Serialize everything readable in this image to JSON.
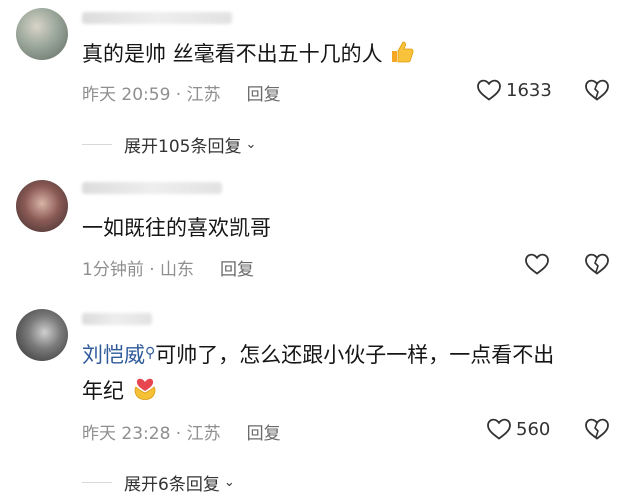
{
  "comments": [
    {
      "text": "真的是帅 丝毫看不出五十几的人",
      "emoji": "thumbs-up",
      "time": "昨天 20:59 · 江苏",
      "reply": "回复",
      "likes": "1633",
      "expand": "展开105条回复"
    },
    {
      "text": "一如既往的喜欢凯哥",
      "time": "1分钟前 · 山东",
      "reply": "回复"
    },
    {
      "mention": "刘恺威",
      "text_line1": "可帅了，怎么还跟小伙子一样，一点看不出",
      "text_line2": "年纪",
      "emoji": "heart-hands",
      "time": "昨天 23:28 · 江苏",
      "reply": "回复",
      "likes": "560",
      "expand": "展开6条回复"
    }
  ],
  "colors": {
    "mention": "#2e5a9a",
    "meta": "#8f8f8f",
    "background": "#ffffff"
  }
}
